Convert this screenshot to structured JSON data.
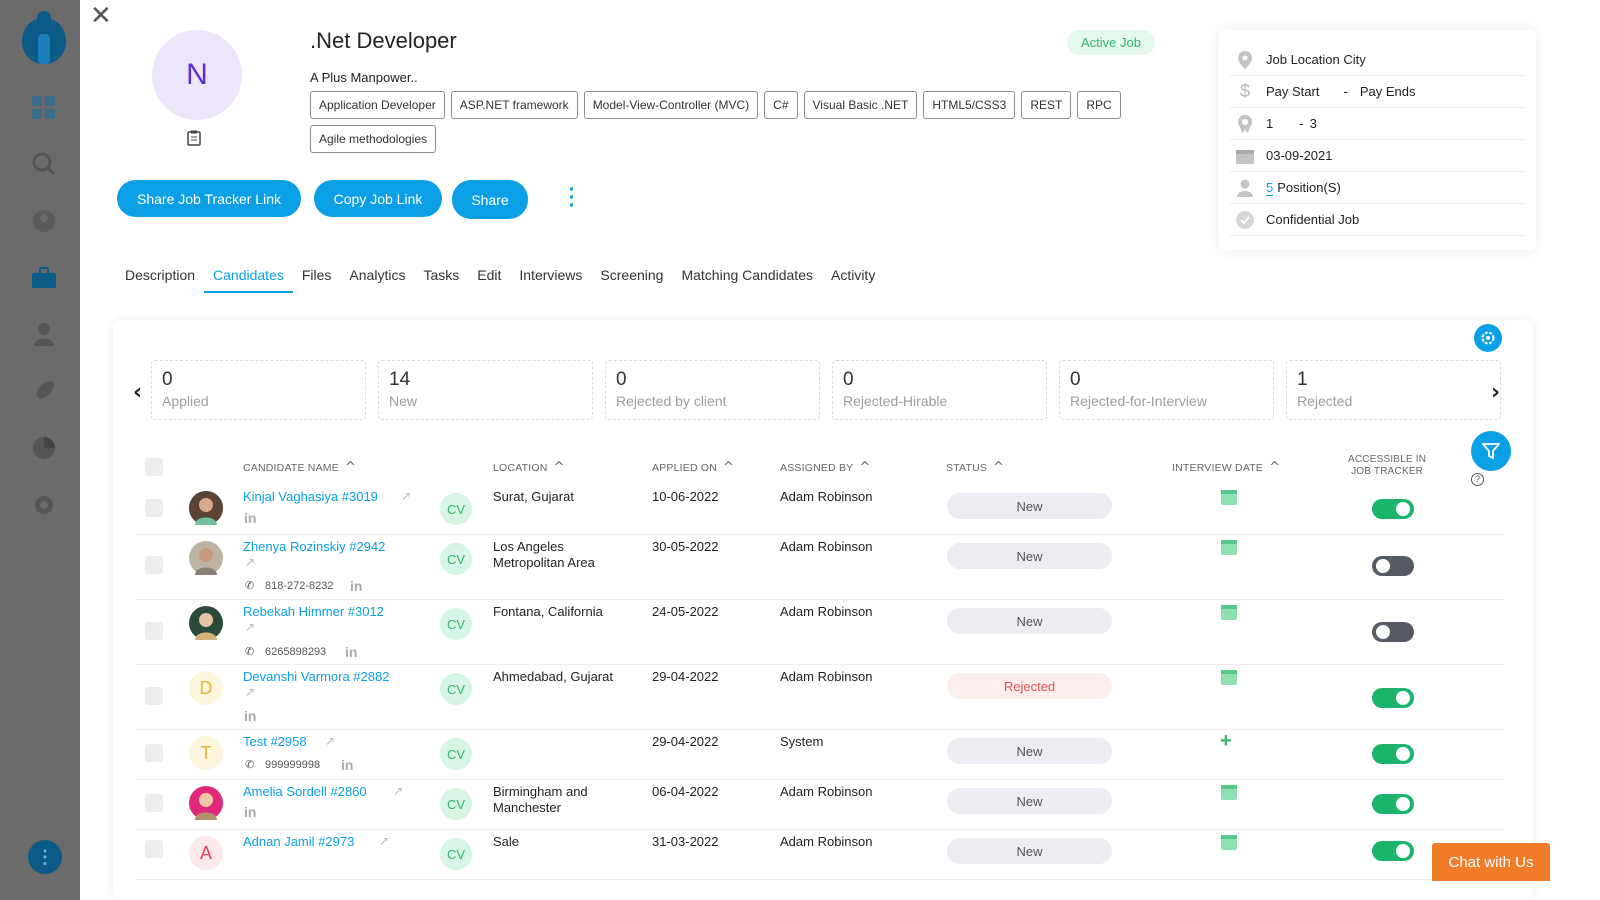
{
  "sidebar": {
    "icons": [
      "dashboard-icon",
      "search-icon",
      "user-icon",
      "briefcase-icon",
      "agent-icon",
      "rocket-icon",
      "chart-icon",
      "settings-icon"
    ],
    "more_label": "⋮"
  },
  "header": {
    "avatar_initial": "N",
    "job_title": ".Net Developer",
    "status_badge": "Active Job",
    "company": "A Plus Manpower..",
    "skills": [
      "Application Developer",
      "ASP.NET framework",
      "Model-View-Controller (MVC)",
      "C#",
      "Visual Basic .NET",
      "HTML5/CSS3",
      "REST",
      "RPC",
      "Agile methodologies"
    ],
    "buttons": {
      "share_tracker": "Share Job Tracker Link",
      "copy_link": "Copy Job Link",
      "share": "Share"
    }
  },
  "info": {
    "location": "Job Location City",
    "pay_start": "Pay Start",
    "pay_sep": "-",
    "pay_end": "Pay Ends",
    "exp_min": "1",
    "exp_sep": "-",
    "exp_max": "3",
    "date": "03-09-2021",
    "positions_count": "5",
    "positions_label": "Position(S)",
    "confidential": "Confidential Job"
  },
  "tabs": [
    "Description",
    "Candidates",
    "Files",
    "Analytics",
    "Tasks",
    "Edit",
    "Interviews",
    "Screening",
    "Matching Candidates",
    "Activity"
  ],
  "active_tab": "Candidates",
  "stats": [
    {
      "num": "0",
      "label": "Applied"
    },
    {
      "num": "14",
      "label": "New"
    },
    {
      "num": "0",
      "label": "Rejected by client"
    },
    {
      "num": "0",
      "label": "Rejected-Hirable"
    },
    {
      "num": "0",
      "label": "Rejected-for-Interview"
    },
    {
      "num": "1",
      "label": "Rejected"
    }
  ],
  "table": {
    "headers": {
      "name": "CANDIDATE NAME",
      "location": "LOCATION",
      "applied": "APPLIED ON",
      "assigned": "ASSIGNED BY",
      "status": "STATUS",
      "interview": "INTERVIEW DATE",
      "accessible_1": "ACCESSIBLE IN",
      "accessible_2": "JOB TRACKER"
    },
    "cv_label": "CV",
    "rows": [
      {
        "name": "Kinjal Vaghasiya #3019",
        "location": "Surat, Gujarat",
        "location2": "",
        "applied": "10-06-2022",
        "assigned": "Adam Robinson",
        "status": "New",
        "phone": "",
        "initial": "",
        "accessible": true
      },
      {
        "name": "Zhenya Rozinskiy #2942",
        "location": "Los Angeles",
        "location2": "Metropolitan Area",
        "applied": "30-05-2022",
        "assigned": "Adam Robinson",
        "status": "New",
        "phone": "818-272-8232",
        "initial": "",
        "accessible": false
      },
      {
        "name": "Rebekah Himmer #3012",
        "location": "Fontana, California",
        "location2": "",
        "applied": "24-05-2022",
        "assigned": "Adam Robinson",
        "status": "New",
        "phone": "6265898293",
        "initial": "",
        "accessible": false
      },
      {
        "name": "Devanshi Varmora #2882",
        "location": "Ahmedabad, Gujarat",
        "location2": "",
        "applied": "29-04-2022",
        "assigned": "Adam Robinson",
        "status": "Rejected",
        "phone": "",
        "initial": "D",
        "accessible": true
      },
      {
        "name": "Test #2958",
        "location": "",
        "location2": "",
        "applied": "29-04-2022",
        "assigned": "System",
        "status": "New",
        "phone": "999999998",
        "initial": "T",
        "accessible": true
      },
      {
        "name": "Amelia Sordell #2860",
        "location": "Birmingham and",
        "location2": "Manchester",
        "applied": "06-04-2022",
        "assigned": "Adam Robinson",
        "status": "New",
        "phone": "",
        "initial": "",
        "accessible": true
      },
      {
        "name": "Adnan Jamil #2973",
        "location": "Sale",
        "location2": "",
        "applied": "31-03-2022",
        "assigned": "Adam Robinson",
        "status": "New",
        "phone": "",
        "initial": "A",
        "accessible": true
      }
    ]
  },
  "chat": "Chat with Us",
  "colors": {
    "accent": "#0b9fe5",
    "success": "#1ab56b",
    "danger": "#e25454",
    "chat": "#f07c29"
  }
}
